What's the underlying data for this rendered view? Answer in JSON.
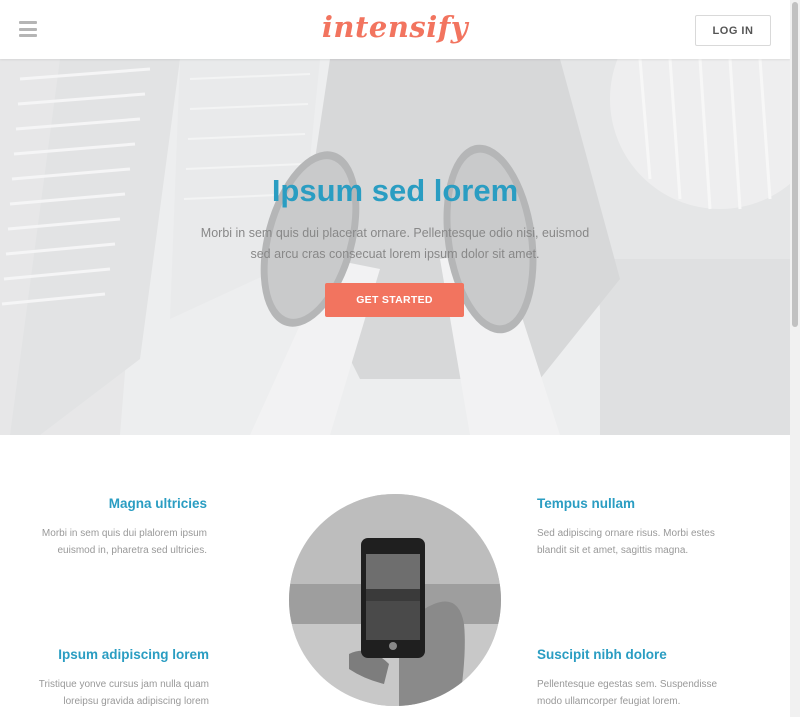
{
  "header": {
    "logo": "intensify",
    "login_label": "LOG IN"
  },
  "hero": {
    "title": "Ipsum sed lorem",
    "text": "Morbi in sem quis dui placerat ornare. Pellentesque odio nisi, euismod sed arcu cras consecuat lorem ipsum dolor sit amet.",
    "cta_label": "GET STARTED"
  },
  "features": {
    "items": [
      {
        "title": "Magna ultricies",
        "text": "Morbi in sem quis dui plalorem ipsum euismod in, pharetra sed ultricies."
      },
      {
        "title": "Tempus nullam",
        "text": "Sed adipiscing ornare risus. Morbi estes blandit sit et amet, sagittis magna."
      },
      {
        "title": "Ipsum adipiscing lorem",
        "text": "Tristique yonve cursus jam nulla quam loreipsu gravida adipiscing lorem"
      },
      {
        "title": "Suscipit nibh dolore",
        "text": "Pellentesque egestas sem. Suspendisse modo ullamcorper feugiat lorem."
      }
    ]
  },
  "colors": {
    "accent": "#f2745f",
    "primary": "#2a9dc2"
  },
  "icons": {
    "menu": "hamburger-menu-icon"
  }
}
